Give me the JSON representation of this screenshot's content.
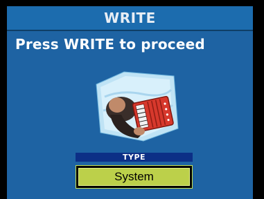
{
  "header": {
    "title": "WRITE"
  },
  "main": {
    "prompt": "Press WRITE to proceed",
    "illustration_icon": "accordion-player-icon",
    "type_label": "TYPE",
    "type_value": "System"
  },
  "colors": {
    "background": "#1e63a3",
    "title_bar": "#1c6cae",
    "type_bar": "#0c2f86",
    "value_box": "#bcd04a"
  }
}
